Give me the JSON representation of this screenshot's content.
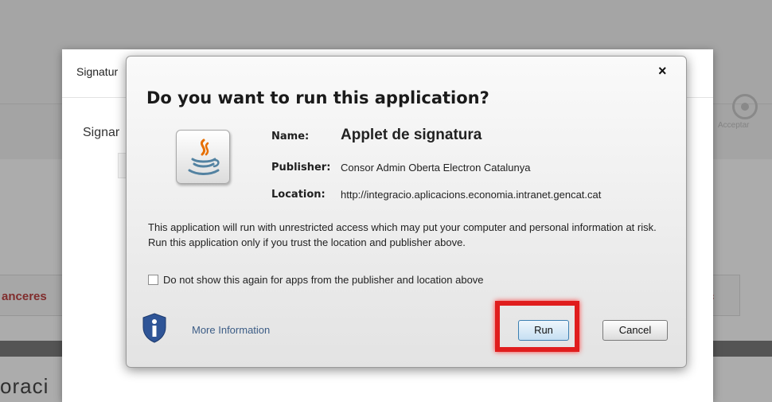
{
  "background": {
    "left_tab_label": "anceres",
    "right_tab_label": "c",
    "right_icon_label": "Acceptar",
    "bottom_text": "oraci"
  },
  "signature_modal": {
    "title": "Signatur",
    "subtitle": "Signar",
    "close_glyph": "×"
  },
  "java_dialog": {
    "close_glyph": "×",
    "heading": "Do you want to run this application?",
    "name_label": "Name:",
    "name_value": "Applet de signatura",
    "publisher_label": "Publisher:",
    "publisher_value": "Consor Admin Oberta Electron Catalunya",
    "location_label": "Location:",
    "location_value": "http://integracio.aplicacions.economia.intranet.gencat.cat",
    "warning_text": "This application will run with unrestricted access which may put your computer and personal information at risk. Run this application only if you trust the location and publisher above.",
    "checkbox_label": "Do not show this again for apps from the publisher and location above",
    "checkbox_checked": false,
    "more_info_label": "More Information",
    "run_label": "Run",
    "cancel_label": "Cancel",
    "highlight_color": "#e01d1d",
    "icons": {
      "app": "java-cup-icon",
      "info": "info-shield-icon"
    }
  }
}
